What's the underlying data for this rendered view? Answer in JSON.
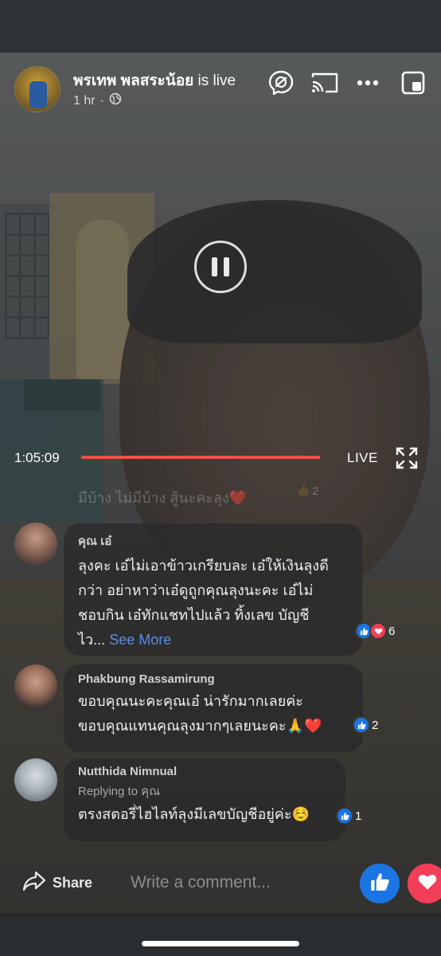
{
  "header": {
    "poster_name": "พรเทพ พลสระน้อย",
    "status_text": " is live",
    "time_ago": "1 hr",
    "separator": "·"
  },
  "player": {
    "elapsed": "1:05:09",
    "progress_fraction": 1.0,
    "live_label": "LIVE"
  },
  "comments": {
    "faded": {
      "text": "มีบ้าง ไม่มีบ้าง สู้นะคะลุง",
      "like_count": "2"
    },
    "items": [
      {
        "author": "คุณ เอ๋",
        "lines": [
          "ลุงคะ เอ๋ไม่เอาข้าวเกรียบละ เอ๋ให้เงินลุงดี",
          "กว่า อย่าหาว่าเอ๋ดูถูกคุณลุงนะคะ เอ๋ไม่",
          "ชอบกิน เอ๋ทักแชทไปแล้ว ทิ้งเลข บัญชี",
          "ไว..."
        ],
        "see_more": "See More",
        "reaction_count": "6"
      },
      {
        "author": "Phakbung Rassamirung",
        "lines": [
          "ขอบคุณนะคะคุณเอ๋ น่ารักมากเลยค่ะ",
          "ขอบคุณแทนคุณลุงมากๆเลยนะคะ"
        ],
        "reaction_count": "2"
      },
      {
        "author": "Nutthida Nimnual",
        "reply_to": "Replying to คุณ",
        "lines": [
          "ตรงสตอรี่ไฮไลท์ลุงมีเลขบัญชีอยู่ค่ะ"
        ],
        "reaction_count": "1"
      }
    ]
  },
  "bottom_bar": {
    "share_label": "Share",
    "comment_placeholder": "Write a comment..."
  },
  "colors": {
    "accent_blue": "#1b74e4",
    "love_red": "#f33e58",
    "progress_red": "#f0504a",
    "see_more_blue": "#5b8ee6"
  },
  "icons": [
    "globe-icon",
    "messenger-icon",
    "cast-icon",
    "more-icon",
    "pip-icon",
    "pause-icon",
    "fullscreen-icon",
    "like-icon",
    "love-icon",
    "share-icon"
  ]
}
